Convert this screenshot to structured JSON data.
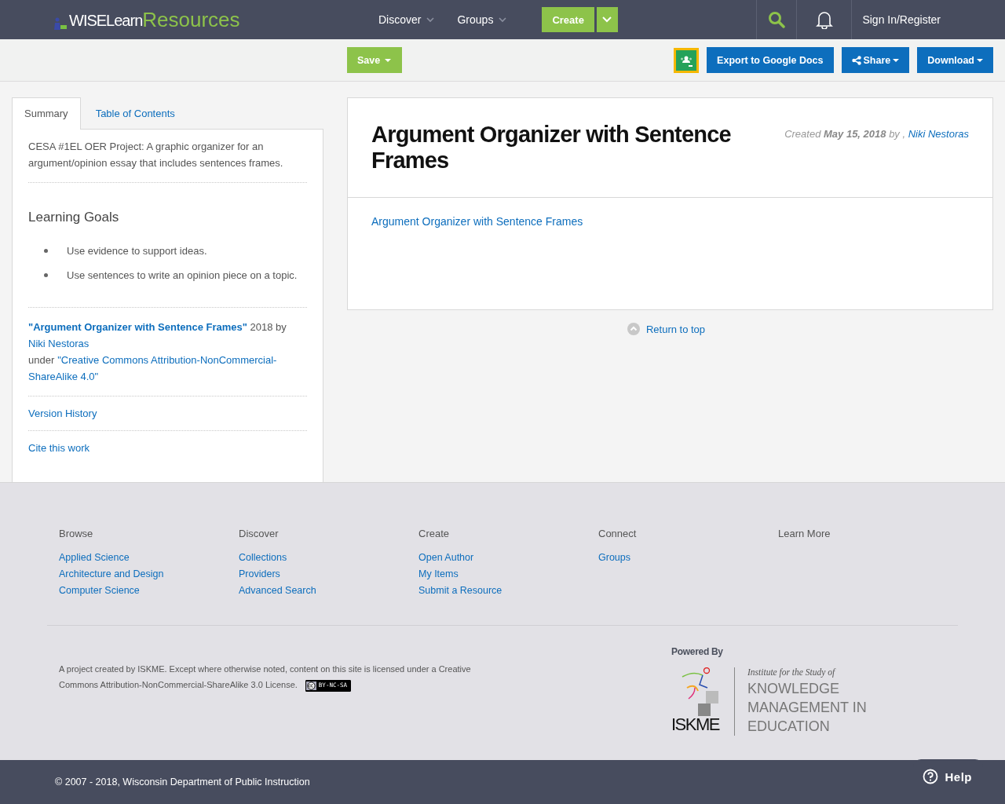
{
  "header": {
    "logo": {
      "brand": "WISELearn",
      "product": "Resources"
    },
    "nav": [
      {
        "label": "Discover"
      },
      {
        "label": "Groups"
      }
    ],
    "create_button": "Create",
    "sign_in": "Sign In/Register"
  },
  "toolbar": {
    "save_button": "Save",
    "export_button": "Export to Google Docs",
    "share_button": "Share",
    "download_button": "Download"
  },
  "sidebar": {
    "tabs": [
      {
        "label": "Summary",
        "selected": true
      },
      {
        "label": "Table of Contents",
        "selected": false
      }
    ],
    "description": "CESA #1EL OER Project: A graphic organizer for an argument/opinion essay that includes sentences frames.",
    "learning_goals": {
      "heading": "Learning Goals",
      "items": [
        "Use evidence to support ideas.",
        "Use sentences to write an opinion piece on a topic."
      ]
    },
    "attribution": {
      "title_link": "\"Argument Organizer with Sentence Frames\"",
      "year_by": "2018 by",
      "author_link": "Niki Nestoras",
      "under": "under",
      "license_link": "\"Creative Commons Attribution-NonCommercial-ShareAlike 4.0\""
    },
    "links": [
      "Version History",
      "Cite this work"
    ]
  },
  "resource": {
    "title": "Argument Organizer with Sentence Frames",
    "created": {
      "label": "Created",
      "date": "May 15, 2018",
      "by": "by ,",
      "author": "Niki Nestoras"
    },
    "file_link": "Argument Organizer with Sentence Frames",
    "return_to_top": "Return to top"
  },
  "footer": {
    "columns": [
      {
        "heading": "Browse",
        "links": [
          "Applied Science",
          "Architecture and Design",
          "Computer Science"
        ]
      },
      {
        "heading": "Discover",
        "links": [
          "Collections",
          "Providers",
          "Advanced Search"
        ]
      },
      {
        "heading": "Create",
        "links": [
          "Open Author",
          "My Items",
          "Submit a Resource"
        ]
      },
      {
        "heading": "Connect",
        "links": [
          "Groups"
        ]
      },
      {
        "heading": "Learn More"
      }
    ],
    "license_text": "A project created by ISKME. Except where otherwise noted, content on this site is licensed under a Creative Commons Attribution-NonCommercial-ShareAlike 3.0 License.",
    "cc_badge": "BY-NC-SA",
    "powered_by": "Powered By",
    "partner": {
      "abbr": "ISKME",
      "tagline": "Institute for the Study of",
      "name": "KNOWLEDGE MANAGEMENT IN EDUCATION"
    },
    "copyright": "© 2007 - 2018, Wisconsin Department of Public Instruction",
    "help_button": "Help"
  }
}
